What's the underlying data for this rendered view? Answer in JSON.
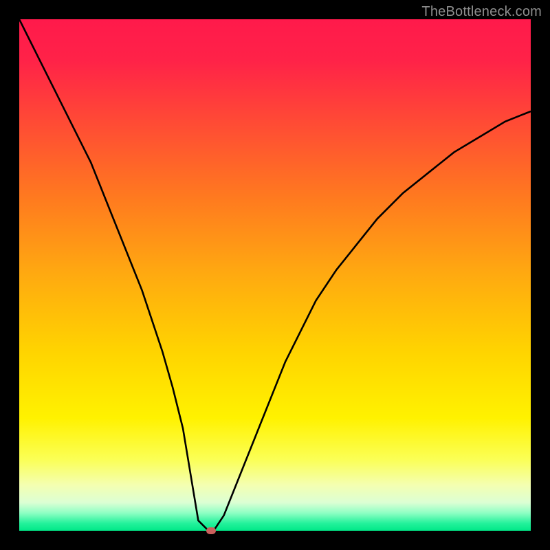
{
  "watermark": "TheBottleneck.com",
  "marker_color": "#c9605c",
  "curve_color": "#000000",
  "gradient_stops": [
    {
      "offset": 0.0,
      "color": "#ff1a4b"
    },
    {
      "offset": 0.08,
      "color": "#ff2248"
    },
    {
      "offset": 0.2,
      "color": "#ff4a35"
    },
    {
      "offset": 0.35,
      "color": "#ff7a1f"
    },
    {
      "offset": 0.5,
      "color": "#ffaa10"
    },
    {
      "offset": 0.65,
      "color": "#ffd400"
    },
    {
      "offset": 0.78,
      "color": "#fff200"
    },
    {
      "offset": 0.86,
      "color": "#fbff55"
    },
    {
      "offset": 0.91,
      "color": "#f4ffb0"
    },
    {
      "offset": 0.945,
      "color": "#dcffd4"
    },
    {
      "offset": 0.965,
      "color": "#8fffc4"
    },
    {
      "offset": 0.985,
      "color": "#25f29c"
    },
    {
      "offset": 1.0,
      "color": "#00e887"
    }
  ],
  "chart_data": {
    "type": "line",
    "title": "",
    "xlabel": "",
    "ylabel": "",
    "xlim": [
      0,
      100
    ],
    "ylim": [
      0,
      100
    ],
    "grid": false,
    "legend": false,
    "series": [
      {
        "name": "bottleneck-curve",
        "x": [
          0,
          2,
          4,
          6,
          8,
          10,
          12,
          14,
          16,
          18,
          20,
          22,
          24,
          26,
          28,
          30,
          32,
          33,
          34,
          35,
          37,
          38,
          40,
          42,
          44,
          46,
          48,
          50,
          52,
          55,
          58,
          62,
          66,
          70,
          75,
          80,
          85,
          90,
          95,
          100
        ],
        "y": [
          100,
          96,
          92,
          88,
          84,
          80,
          76,
          72,
          67,
          62,
          57,
          52,
          47,
          41,
          35,
          28,
          20,
          14,
          8,
          2,
          0,
          0,
          3,
          8,
          13,
          18,
          23,
          28,
          33,
          39,
          45,
          51,
          56,
          61,
          66,
          70,
          74,
          77,
          80,
          82
        ]
      }
    ],
    "marker": {
      "x": 37.5,
      "y": 0
    },
    "background": "rainbow-vertical-gradient"
  }
}
